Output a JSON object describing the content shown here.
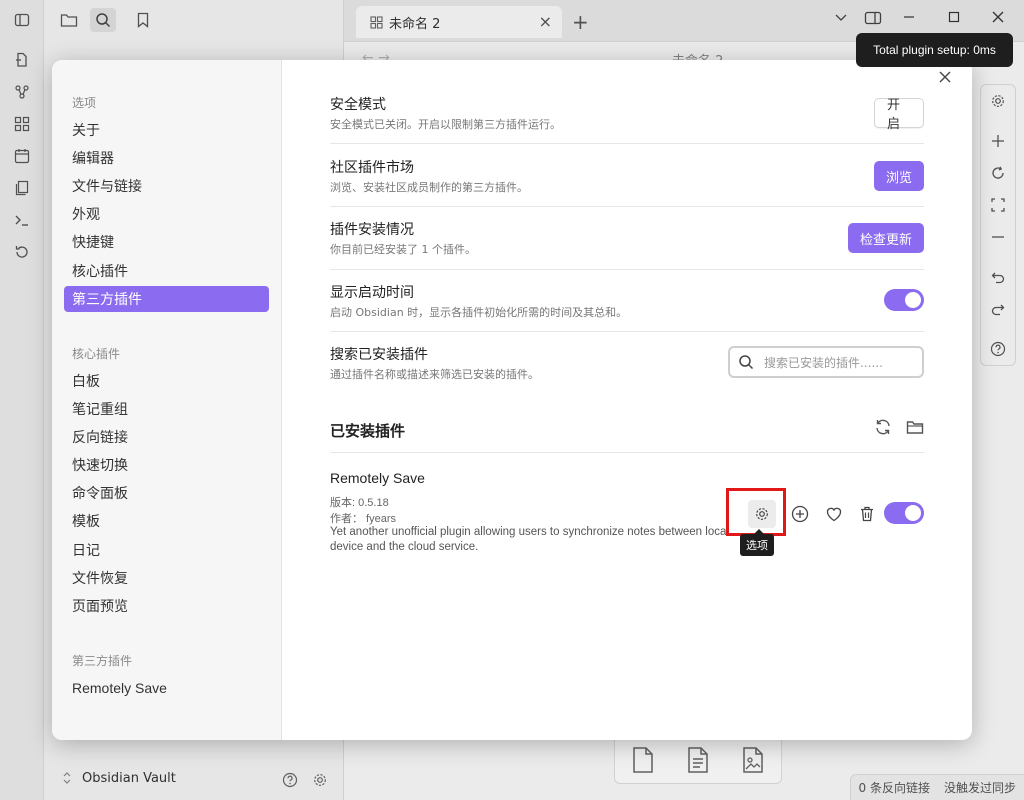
{
  "app": {
    "tab_title": "未命名 2",
    "doc_title": "未命名 2",
    "tab_close": "×",
    "new_tab": "+",
    "vault_name": "Obsidian Vault",
    "statusbar": {
      "backlinks": "0 条反向链接",
      "sync": "没触发过同步"
    },
    "top_tooltip": "Total plugin setup: 0ms",
    "nav_arrows": "←  →"
  },
  "settings_sidebar": {
    "options_heading": "选项",
    "options": [
      "关于",
      "编辑器",
      "文件与链接",
      "外观",
      "快捷键",
      "核心插件",
      "第三方插件"
    ],
    "active_index": 6,
    "core_heading": "核心插件",
    "core": [
      "白板",
      "笔记重组",
      "反向链接",
      "快速切换",
      "命令面板",
      "模板",
      "日记",
      "文件恢复",
      "页面预览"
    ],
    "third_heading": "第三方插件",
    "third": [
      "Remotely Save"
    ]
  },
  "settings": {
    "safe_mode": {
      "name": "安全模式",
      "desc": "安全模式已关闭。开启以限制第三方插件运行。",
      "button": "开启"
    },
    "community": {
      "name": "社区插件市场",
      "desc": "浏览、安装社区成员制作的第三方插件。",
      "button": "浏览"
    },
    "installed_status": {
      "name": "插件安装情况",
      "desc": "你目前已经安装了 1 个插件。",
      "button": "检查更新"
    },
    "startup_time": {
      "name": "显示启动时间",
      "desc": "启动 Obsidian 时，显示各插件初始化所需的时间及其总和。",
      "enabled": true
    },
    "search_installed": {
      "name": "搜索已安装插件",
      "desc": "通过插件名称或描述来筛选已安装的插件。",
      "placeholder": "搜索已安装的插件......"
    }
  },
  "installed_section": {
    "title": "已安装插件",
    "plugin": {
      "name": "Remotely Save",
      "version": "版本: 0.5.18",
      "author": "作者：  fyears",
      "desc": "Yet another unofficial plugin allowing users to synchronize notes between local device and the cloud service.",
      "enabled": true,
      "options_tooltip": "选项"
    }
  },
  "colors": {
    "accent": "#8b6cf0",
    "highlight": "#e01818"
  }
}
